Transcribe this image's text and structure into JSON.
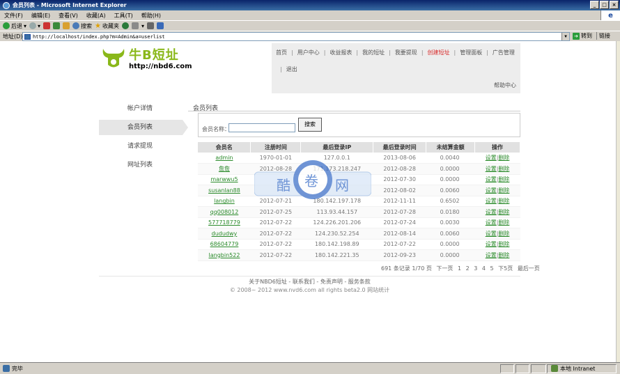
{
  "window": {
    "title": "会员列表 - Microsoft Internet Explorer"
  },
  "menu": [
    "文件(F)",
    "编辑(E)",
    "查看(V)",
    "收藏(A)",
    "工具(T)",
    "帮助(H)"
  ],
  "toolbar": {
    "back": "后退",
    "search": "搜索",
    "favorites": "收藏夹"
  },
  "address": {
    "label": "地址(D)",
    "url": "http://localhost/index.php?m=Admin&a=userlist",
    "go": "转到",
    "links": "链接"
  },
  "site": {
    "logo_text": "牛B短址",
    "logo_url": "http://nbd6.com"
  },
  "nav": {
    "items": [
      "首页",
      "用户中心",
      "收益报表",
      "我的短址",
      "我要提现",
      "创建短址",
      "管理面板",
      "广告管理"
    ],
    "logout": "退出",
    "help": "帮助中心"
  },
  "sidebar": {
    "items": [
      "帐户详情",
      "会员列表",
      "请求提现",
      "网址列表"
    ]
  },
  "content": {
    "title": "会员列表",
    "search_label": "会员名称：",
    "search_value": "",
    "search_button": "搜索"
  },
  "table": {
    "headers": [
      "会员名",
      "注册时间",
      "最后登录IP",
      "最后登录时间",
      "未结算金额",
      "操作"
    ],
    "rows": [
      {
        "name": "admin",
        "reg": "1970-01-01",
        "ip": "127.0.0.1",
        "last": "2013-08-06",
        "amount": "0.0040"
      },
      {
        "name": "詹詹",
        "reg": "2012-08-28",
        "ip": "171.173.218.247",
        "last": "2012-08-28",
        "amount": "0.0000"
      },
      {
        "name": "marwwu5",
        "reg": "",
        "ip": "",
        "last": "2012-07-30",
        "amount": "0.0000"
      },
      {
        "name": "susanlan88",
        "reg": "",
        "ip": "",
        "last": "2012-08-02",
        "amount": "0.0060"
      },
      {
        "name": "langbin",
        "reg": "2012-07-21",
        "ip": "180.142.197.178",
        "last": "2012-11-11",
        "amount": "0.6502"
      },
      {
        "name": "qq008012",
        "reg": "2012-07-25",
        "ip": "113.93.44.157",
        "last": "2012-07-28",
        "amount": "0.0180"
      },
      {
        "name": "577718779",
        "reg": "2012-07-22",
        "ip": "124.226.201.206",
        "last": "2012-07-24",
        "amount": "0.0030"
      },
      {
        "name": "dudud​wy",
        "reg": "2012-07-22",
        "ip": "124.230.52.254",
        "last": "2012-08-14",
        "amount": "0.0060"
      },
      {
        "name": "68604779",
        "reg": "2012-07-22",
        "ip": "180.142.198.89",
        "last": "2012-07-22",
        "amount": "0.0000"
      },
      {
        "name": "langbin522",
        "reg": "2012-07-22",
        "ip": "180.142.221.35",
        "last": "2012-09-23",
        "amount": "0.0000"
      }
    ],
    "op_set": "设置",
    "op_sep": "|",
    "op_delete": "删除"
  },
  "pagination": {
    "summary": "691 条记录 1/70 页",
    "next": "下一页",
    "pages": [
      "1",
      "2",
      "3",
      "4",
      "5"
    ],
    "next5": "下5页",
    "last": "最后一页"
  },
  "footer": {
    "links": "关于NBD6短址 - 联系我们 - 免责声明 - 服务条款",
    "copyright": "© 2008~ 2012 www.nvd6.com all rights beta2.0 网站统计"
  },
  "watermark": {
    "text": "酷卷网"
  },
  "status": {
    "left": "完毕",
    "zone": "本地 Intranet"
  },
  "colors": {
    "accent_green": "#8ab81a",
    "link_green": "#2a8a2a",
    "active_red": "#d82c2c"
  }
}
